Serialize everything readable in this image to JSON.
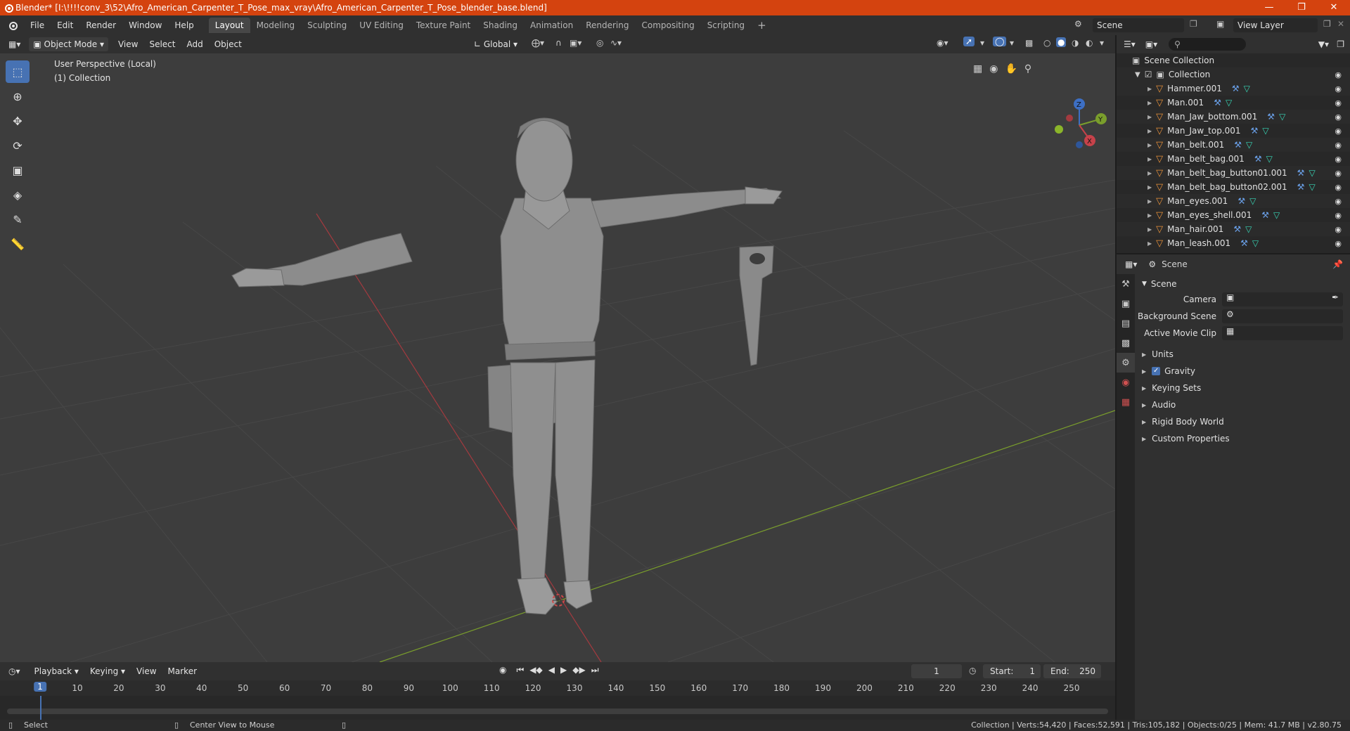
{
  "window": {
    "title": "Blender* [I:\\!!!!conv_3\\52\\Afro_American_Carpenter_T_Pose_max_vray\\Afro_American_Carpenter_T_Pose_blender_base.blend]"
  },
  "menu": {
    "items": [
      "File",
      "Edit",
      "Render",
      "Window",
      "Help"
    ]
  },
  "workspaces": {
    "tabs": [
      "Layout",
      "Modeling",
      "Sculpting",
      "UV Editing",
      "Texture Paint",
      "Shading",
      "Animation",
      "Rendering",
      "Compositing",
      "Scripting"
    ],
    "active": "Layout"
  },
  "scene_selector": {
    "value": "Scene"
  },
  "view_layer_selector": {
    "value": "View Layer"
  },
  "viewport_header": {
    "mode": "Object Mode",
    "menus": [
      "View",
      "Select",
      "Add",
      "Object"
    ],
    "transform_orientation": "Global"
  },
  "viewport": {
    "perspective_label": "User Perspective (Local)",
    "collection_label": "(1) Collection",
    "gizmo_axes": [
      "X",
      "Y",
      "Z"
    ]
  },
  "outliner": {
    "root": "Scene Collection",
    "collection": "Collection",
    "objects": [
      "Hammer.001",
      "Man.001",
      "Man_Jaw_bottom.001",
      "Man_Jaw_top.001",
      "Man_belt.001",
      "Man_belt_bag.001",
      "Man_belt_bag_button01.001",
      "Man_belt_bag_button02.001",
      "Man_eyes.001",
      "Man_eyes_shell.001",
      "Man_hair.001",
      "Man_leash.001"
    ]
  },
  "properties": {
    "context": "Scene",
    "panel_title": "Scene",
    "fields": {
      "camera_label": "Camera",
      "background_scene_label": "Background Scene",
      "active_movie_clip_label": "Active Movie Clip"
    },
    "sections": [
      "Units",
      "Gravity",
      "Keying Sets",
      "Audio",
      "Rigid Body World",
      "Custom Properties"
    ],
    "gravity_checked": true
  },
  "timeline": {
    "menus": [
      "Playback",
      "Keying",
      "View",
      "Marker"
    ],
    "current_frame": "1",
    "start_label": "Start:",
    "start_value": "1",
    "end_label": "End:",
    "end_value": "250",
    "ruler_ticks": [
      "1",
      "10",
      "20",
      "30",
      "40",
      "50",
      "60",
      "70",
      "80",
      "90",
      "100",
      "110",
      "120",
      "130",
      "140",
      "150",
      "160",
      "170",
      "180",
      "190",
      "200",
      "210",
      "220",
      "230",
      "240",
      "250"
    ]
  },
  "statusbar": {
    "left_action": "Select",
    "middle_action": "Center View to Mouse",
    "stats": "Collection | Verts:54,420 | Faces:52,591 | Tris:105,182 | Objects:0/25 | Mem: 41.7 MB | v2.80.75"
  },
  "colors": {
    "titlebar": "#d4430f",
    "accent_blue": "#4772b3",
    "x_axis": "#c6424a",
    "y_axis": "#7a9e2c",
    "object_orange": "#e8913a",
    "modifier_blue": "#6aa0e8",
    "mesh_green": "#38d6b6"
  }
}
